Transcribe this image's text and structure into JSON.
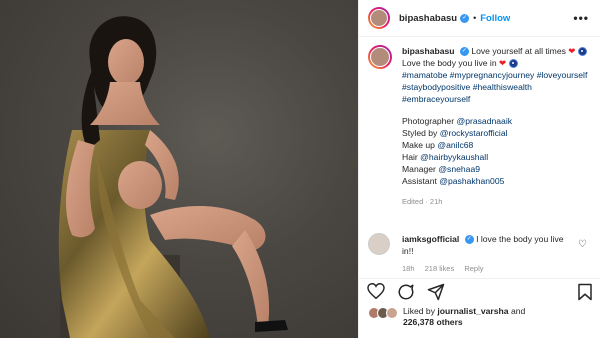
{
  "post": {
    "username": "bipashabasu",
    "follow_label": "Follow",
    "separator": "•",
    "more_label": "•••",
    "caption": {
      "line1": "Love yourself at all times",
      "line2": "Love the body you live in",
      "hashtags": "#mamatobe #mypregnancyjourney #loveyourself #staybodypositive #healthiswealth #embraceyourself",
      "credits": [
        {
          "label": "Photographer",
          "handle": "@prasadnaaik"
        },
        {
          "label": "Styled by",
          "handle": "@rockystarofficial"
        },
        {
          "label": "Make up",
          "handle": "@anilc68"
        },
        {
          "label": "Hair",
          "handle": "@hairbyykaushall"
        },
        {
          "label": "Manager",
          "handle": "@snehaa9"
        },
        {
          "label": "Assistant",
          "handle": "@pashakhan005"
        }
      ],
      "edited": "Edited · 21h"
    },
    "comment": {
      "username": "iamksgofficial",
      "text": "I love the body you live in!!",
      "time": "18h",
      "likes": "218 likes",
      "reply": "Reply"
    },
    "likes": {
      "liked_by": "Liked by",
      "user": "journalist_varsha",
      "and": "and",
      "others": "226,378 others"
    }
  },
  "icons": [
    "verified-icon",
    "more-icon",
    "heart-icon",
    "comment-icon",
    "share-icon",
    "save-icon"
  ],
  "colors": {
    "link": "#00376b",
    "follow": "#0095f6",
    "verified": "#3897f0",
    "meta": "#8e8e8e"
  }
}
